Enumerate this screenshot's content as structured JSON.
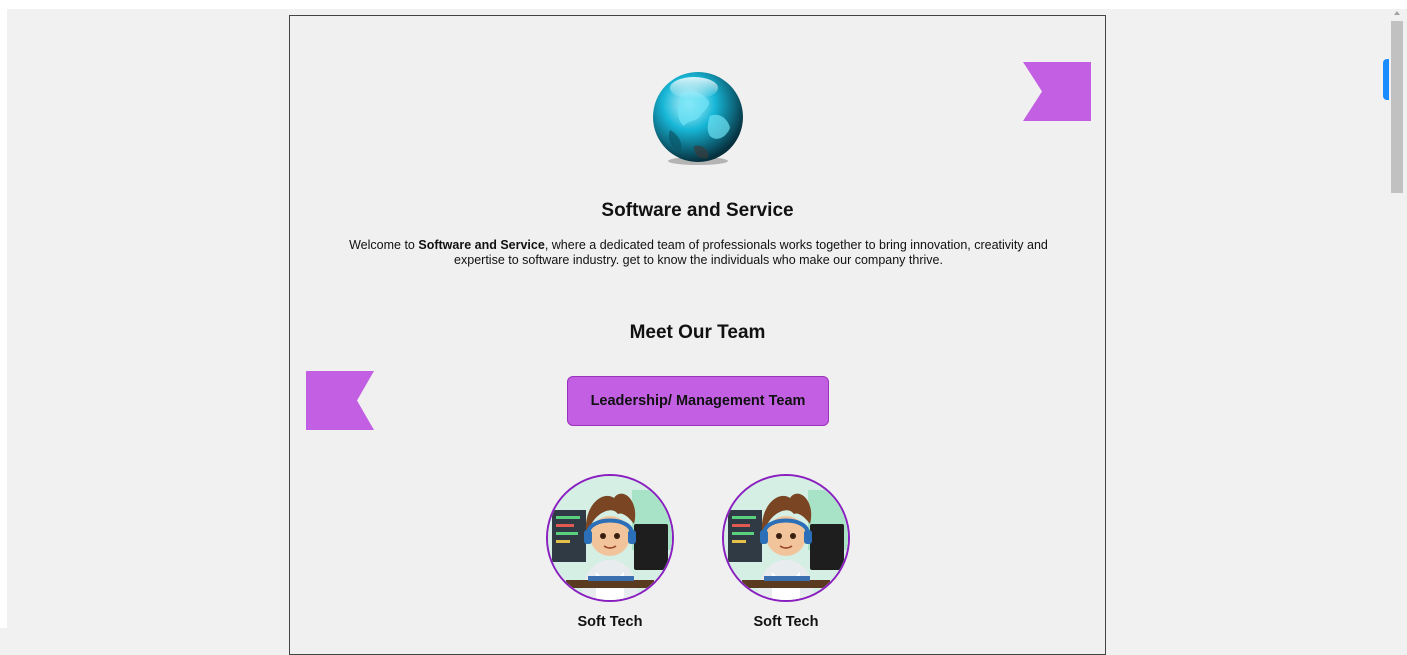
{
  "header": {
    "title": "Software and Service",
    "intro_prefix": "Welcome to ",
    "intro_bold": "Software and Service",
    "intro_suffix": ", where a dedicated team of professionals works together to bring innovation, creativity and expertise to software industry. get to know the individuals who make our company thrive."
  },
  "team": {
    "heading": "Meet Our Team",
    "leadership_button": "Leadership/ Management Team",
    "members": [
      {
        "name": "Soft Tech"
      },
      {
        "name": "Soft Tech"
      }
    ]
  },
  "colors": {
    "accent": "#c25fe3",
    "avatar_border": "#8a1fc0",
    "background": "#f0f0f0"
  },
  "icons": {
    "logo": "globe-icon",
    "avatar": "developer-avatar-icon"
  }
}
